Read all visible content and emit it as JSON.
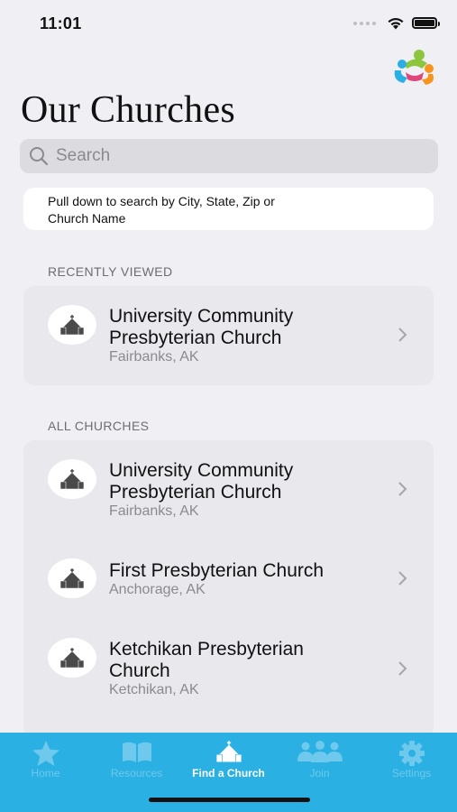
{
  "status_bar": {
    "time": "11:01"
  },
  "page": {
    "title": "Our Churches"
  },
  "search": {
    "placeholder": "Search"
  },
  "hint": {
    "line1": "Pull down to search by City, State, Zip or",
    "line2": "Church Name"
  },
  "recently_viewed": {
    "header": "RECENTLY VIEWED",
    "items": [
      {
        "name_line1": "University Community",
        "name_line2": "Presbyterian Church",
        "location": "Fairbanks, AK"
      }
    ]
  },
  "all_churches": {
    "header": "ALL CHURCHES",
    "items": [
      {
        "name_line1": "University Community",
        "name_line2": "Presbyterian Church",
        "location": "Fairbanks, AK"
      },
      {
        "name_line1": "First Presbyterian Church",
        "name_line2": "",
        "location": "Anchorage, AK"
      },
      {
        "name_line1": "Ketchikan Presbyterian",
        "name_line2": "Church",
        "location": "Ketchikan, AK"
      }
    ]
  },
  "tab_bar": {
    "tabs": [
      {
        "label": "Home",
        "icon": "star-icon"
      },
      {
        "label": "Resources",
        "icon": "book-icon"
      },
      {
        "label": "Find a Church",
        "icon": "church-icon",
        "active": true
      },
      {
        "label": "Join",
        "icon": "people-icon"
      },
      {
        "label": "Settings",
        "icon": "gear-icon"
      }
    ]
  },
  "colors": {
    "tab_bar": "#2ab0e2",
    "background": "#efeff4",
    "card": "#e8e8ed"
  }
}
